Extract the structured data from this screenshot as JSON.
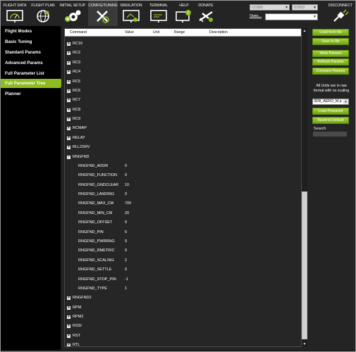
{
  "toolbar": {
    "items": [
      {
        "label": "FLIGHT DATA",
        "icon": "monitor-gauge-icon"
      },
      {
        "label": "FLIGHT PLAN",
        "icon": "globe-icon"
      },
      {
        "label": "INITIAL SETUP",
        "icon": "gears-plus-icon"
      },
      {
        "label": "CONFIG/TUNING",
        "icon": "wrench-screwdriver-icon"
      },
      {
        "label": "SIMULATION",
        "icon": "monitor-sim-icon"
      },
      {
        "label": "TERMINAL",
        "icon": "terminal-icon"
      },
      {
        "label": "HELP",
        "icon": "help-monitor-icon"
      },
      {
        "label": "DONATE",
        "icon": "airplane-icon"
      }
    ],
    "active": "CONFIG/TUNING",
    "port": "COM6",
    "baud": "57600",
    "stats_label": "Stats...",
    "disconnect_label": "DISCONNECT"
  },
  "nav": {
    "items": [
      "Flight Modes",
      "Basic Tuning",
      "Standard Params",
      "Advanced Params",
      "Full Parameter List",
      "Full Parameter Tree",
      "Planner"
    ],
    "active": "Full Parameter Tree"
  },
  "grid": {
    "columns": [
      "Command",
      "Value",
      "Unit",
      "Range",
      "Description"
    ],
    "rows": [
      {
        "name": "RC16",
        "expand": "+"
      },
      {
        "name": "RC2",
        "expand": "+"
      },
      {
        "name": "RC3",
        "expand": "+"
      },
      {
        "name": "RC4",
        "expand": "+"
      },
      {
        "name": "RC5",
        "expand": "+"
      },
      {
        "name": "RC6",
        "expand": "+"
      },
      {
        "name": "RC7",
        "expand": "+"
      },
      {
        "name": "RC8",
        "expand": "+"
      },
      {
        "name": "RC9",
        "expand": "+"
      },
      {
        "name": "RCMAP",
        "expand": "+"
      },
      {
        "name": "RELAY",
        "expand": "+"
      },
      {
        "name": "RLL2SRV",
        "expand": "+"
      },
      {
        "name": "RNGFND",
        "expand": "-"
      },
      {
        "name": "RNGFND_ADDR",
        "value": "0",
        "child": true
      },
      {
        "name": "RNGFND_FUNCTION",
        "value": "0",
        "child": true
      },
      {
        "name": "RNGFND_GNDCLEAR",
        "value": "10",
        "child": true
      },
      {
        "name": "RNGFND_LANDING",
        "value": "0",
        "child": true
      },
      {
        "name": "RNGFND_MAX_CM",
        "value": "700",
        "child": true
      },
      {
        "name": "RNGFND_MIN_CM",
        "value": "20",
        "child": true
      },
      {
        "name": "RNGFND_OFFSET",
        "value": "0",
        "child": true
      },
      {
        "name": "RNGFND_PIN",
        "value": "5",
        "child": true
      },
      {
        "name": "RNGFND_PWRRNG",
        "value": "0",
        "child": true
      },
      {
        "name": "RNGFND_RMETRIC",
        "value": "0",
        "child": true
      },
      {
        "name": "RNGFND_SCALING",
        "value": "2",
        "child": true
      },
      {
        "name": "RNGFND_SETTLE",
        "value": "0",
        "child": true
      },
      {
        "name": "RNGFND_STOP_PIN",
        "value": "-1",
        "child": true
      },
      {
        "name": "RNGFND_TYPE",
        "value": "1",
        "child": true
      },
      {
        "name": "RNGFND2",
        "expand": "+"
      },
      {
        "name": "RPM",
        "expand": "+"
      },
      {
        "name": "RPM2",
        "expand": "+"
      },
      {
        "name": "RSSI",
        "expand": "+"
      },
      {
        "name": "RST",
        "expand": "+"
      },
      {
        "name": "RTL",
        "expand": "+"
      }
    ]
  },
  "right": {
    "load_from_file": "Load from file",
    "save_to_file": "Save to file",
    "write_params": "Write Params",
    "refresh_params": "Refresh Params",
    "compare_params": "Compare Params",
    "note": "All Units are in raw format with no scaling",
    "combo_value": "3DR_AERO_M.p",
    "load_presaved": "Load Presaved",
    "reset_to_default": "Reset to Default",
    "search_label": "Search"
  },
  "colors": {
    "accent_green": "#8cbc1f",
    "background": "#242424"
  }
}
